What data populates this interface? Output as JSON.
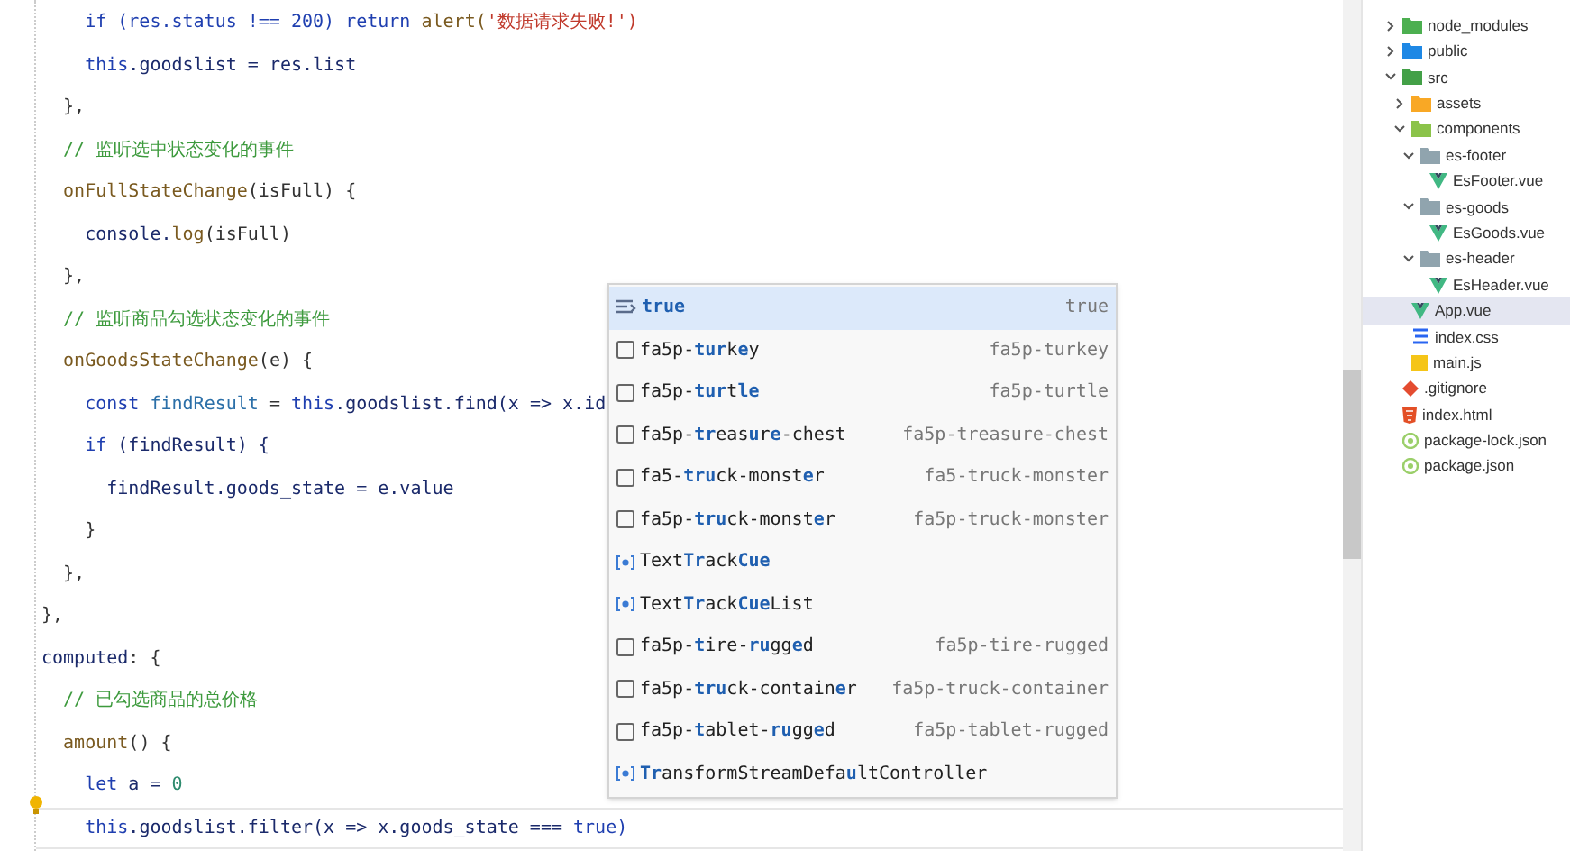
{
  "editor": {
    "lines": [
      {
        "current": false,
        "tokens": [
          {
            "text": "    if (res.status !== 200) ",
            "kind": "kw"
          },
          {
            "text": "return ",
            "kind": "kw"
          },
          {
            "text": "alert(",
            "kind": "fn"
          },
          {
            "text": "'数据请求失败!')",
            "kind": "str"
          }
        ]
      },
      {
        "current": false,
        "tokens": [
          {
            "text": "    this",
            "kind": "kw"
          },
          {
            "text": ".goodslist = res.list",
            "kind": "var"
          }
        ]
      },
      {
        "current": false,
        "tokens": [
          {
            "text": "  },",
            "kind": "plain"
          }
        ]
      },
      {
        "current": false,
        "tokens": [
          {
            "text": "  // 监听选中状态变化的事件",
            "kind": "comment"
          }
        ]
      },
      {
        "current": false,
        "tokens": [
          {
            "text": "  onFullStateChange",
            "kind": "fn"
          },
          {
            "text": "(isFull) {",
            "kind": "plain"
          }
        ]
      },
      {
        "current": false,
        "tokens": [
          {
            "text": "    console.",
            "kind": "var"
          },
          {
            "text": "log",
            "kind": "fn"
          },
          {
            "text": "(isFull)",
            "kind": "plain"
          }
        ]
      },
      {
        "current": false,
        "tokens": [
          {
            "text": "  },",
            "kind": "plain"
          }
        ]
      },
      {
        "current": false,
        "tokens": [
          {
            "text": "  // 监听商品勾选状态变化的事件",
            "kind": "comment"
          }
        ]
      },
      {
        "current": false,
        "tokens": [
          {
            "text": "  onGoodsStateChange",
            "kind": "fn"
          },
          {
            "text": "(e) {",
            "kind": "plain"
          }
        ]
      },
      {
        "current": false,
        "tokens": [
          {
            "text": "    const ",
            "kind": "kw"
          },
          {
            "text": "findResult",
            "kind": "var2"
          },
          {
            "text": " = ",
            "kind": "plain"
          },
          {
            "text": "this",
            "kind": "kw"
          },
          {
            "text": ".goodslist.find(x => x.id",
            "kind": "var"
          }
        ]
      },
      {
        "current": false,
        "tokens": [
          {
            "text": "    if ",
            "kind": "kw"
          },
          {
            "text": "(findResult) {",
            "kind": "var"
          }
        ]
      },
      {
        "current": false,
        "tokens": [
          {
            "text": "      findResult.goods_state = e.value",
            "kind": "var"
          }
        ]
      },
      {
        "current": false,
        "tokens": [
          {
            "text": "    }",
            "kind": "plain"
          }
        ]
      },
      {
        "current": false,
        "tokens": [
          {
            "text": "  },",
            "kind": "plain"
          }
        ]
      },
      {
        "current": false,
        "tokens": [
          {
            "text": "},",
            "kind": "plain"
          }
        ]
      },
      {
        "current": false,
        "tokens": [
          {
            "text": "computed",
            "kind": "var"
          },
          {
            "text": ": {",
            "kind": "plain"
          }
        ]
      },
      {
        "current": false,
        "tokens": [
          {
            "text": "  // 已勾选商品的总价格",
            "kind": "comment"
          }
        ]
      },
      {
        "current": false,
        "tokens": [
          {
            "text": "  amount",
            "kind": "fn"
          },
          {
            "text": "() {",
            "kind": "plain"
          }
        ]
      },
      {
        "current": false,
        "tokens": [
          {
            "text": "    let ",
            "kind": "kw"
          },
          {
            "text": "a = ",
            "kind": "var"
          },
          {
            "text": "0",
            "kind": "num"
          }
        ]
      },
      {
        "current": true,
        "tokens": [
          {
            "text": "    this",
            "kind": "kw"
          },
          {
            "text": ".goodslist.filter(x => x.goods_state === ",
            "kind": "var"
          },
          {
            "text": "true)",
            "kind": "kw"
          }
        ]
      }
    ]
  },
  "suggestions": [
    {
      "kind": "keyword",
      "label": "**true**",
      "detail": "true",
      "selected": true
    },
    {
      "kind": "snippet",
      "label": "fa5p-**tur**k**e**y",
      "detail": "fa5p-turkey",
      "selected": false
    },
    {
      "kind": "snippet",
      "label": "fa5p-**tur**t**le**",
      "detail": "fa5p-turtle",
      "selected": false
    },
    {
      "kind": "snippet",
      "label": "fa5p-**tr**eas**u**r**e**-chest",
      "detail": "fa5p-treasure-chest",
      "selected": false
    },
    {
      "kind": "snippet",
      "label": "fa5-**tru**ck-monst**e**r",
      "detail": "fa5-truck-monster",
      "selected": false
    },
    {
      "kind": "snippet",
      "label": "fa5p-**tru**ck-monst**e**r",
      "detail": "fa5p-truck-monster",
      "selected": false
    },
    {
      "kind": "variable",
      "label": "Text**Tr**ack**Cue**",
      "selected": false
    },
    {
      "kind": "variable",
      "label": "Text**Tr**ack**Cue**List",
      "selected": false
    },
    {
      "kind": "snippet",
      "label": "fa5p-**t**ire-**ru**gg**e**d",
      "detail": "fa5p-tire-rugged",
      "selected": false
    },
    {
      "kind": "snippet",
      "label": "fa5p-**tru**ck-contain**e**r",
      "detail": "fa5p-truck-container",
      "selected": false
    },
    {
      "kind": "snippet",
      "label": "fa5p-**t**ablet-**ru**gg**e**d",
      "detail": "fa5p-tablet-rugged",
      "selected": false
    },
    {
      "kind": "variable",
      "label": "**Tr**ansformStreamDefa**u**ltController",
      "selected": false
    }
  ],
  "explorer": {
    "items": [
      {
        "name": "node_modules",
        "kind": "folder",
        "color": "#4caf50",
        "expanded": false,
        "selected": false
      },
      {
        "name": "public",
        "kind": "folder",
        "color": "#1e88e5",
        "expanded": false,
        "selected": false
      },
      {
        "name": "src",
        "kind": "folder",
        "color": "#43a047",
        "expanded": true,
        "selected": false,
        "children": [
          {
            "name": "assets",
            "kind": "folder",
            "color": "#f9a825",
            "expanded": false,
            "selected": false
          },
          {
            "name": "components",
            "kind": "folder",
            "color": "#8bc34a",
            "expanded": true,
            "selected": false,
            "children": [
              {
                "name": "es-footer",
                "kind": "folder",
                "color": "#90a4ae",
                "expanded": true,
                "selected": false,
                "children": [
                  {
                    "name": "EsFooter.vue",
                    "kind": "vue",
                    "selected": false
                  }
                ]
              },
              {
                "name": "es-goods",
                "kind": "folder",
                "color": "#90a4ae",
                "expanded": true,
                "selected": false,
                "children": [
                  {
                    "name": "EsGoods.vue",
                    "kind": "vue",
                    "selected": false
                  }
                ]
              },
              {
                "name": "es-header",
                "kind": "folder",
                "color": "#90a4ae",
                "expanded": true,
                "selected": false,
                "children": [
                  {
                    "name": "EsHeader.vue",
                    "kind": "vue",
                    "selected": false
                  }
                ]
              }
            ]
          },
          {
            "name": "App.vue",
            "kind": "vue",
            "selected": true
          },
          {
            "name": "index.css",
            "kind": "css",
            "selected": false
          },
          {
            "name": "main.js",
            "kind": "js",
            "selected": false
          }
        ]
      },
      {
        "name": ".gitignore",
        "kind": "git",
        "selected": false
      },
      {
        "name": "index.html",
        "kind": "html",
        "selected": false
      },
      {
        "name": "package-lock.json",
        "kind": "json",
        "selected": false
      },
      {
        "name": "package.json",
        "kind": "json",
        "selected": false
      }
    ]
  }
}
